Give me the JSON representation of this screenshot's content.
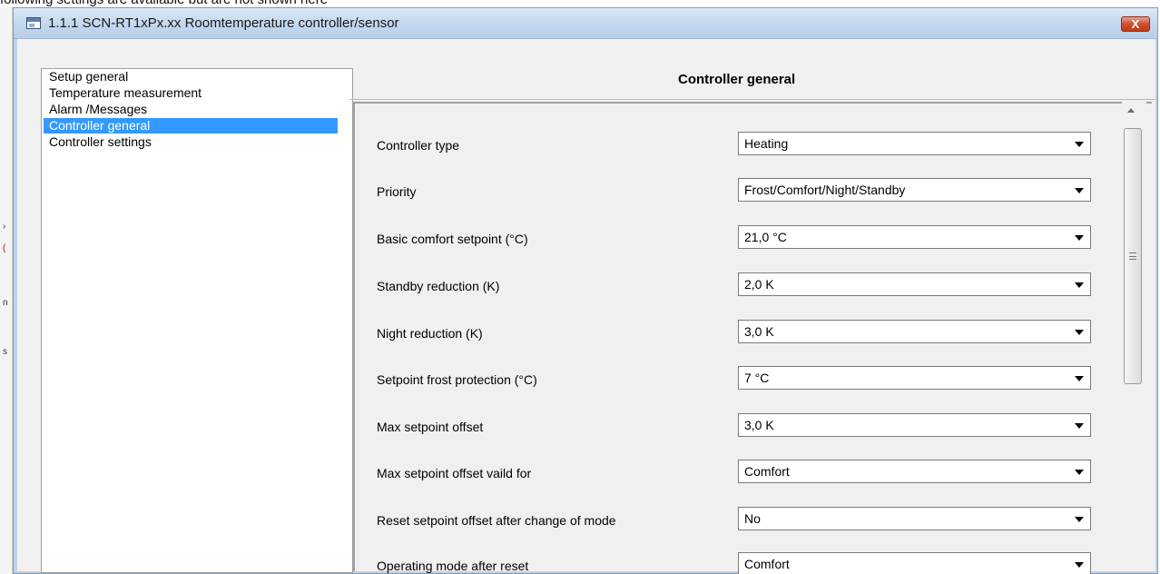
{
  "document_caption": "following settings are available but are not shown here",
  "window": {
    "title": "1.1.1 SCN-RT1xPx.xx Roomtemperature controller/sensor",
    "close_label": "X"
  },
  "tree": {
    "items": [
      {
        "label": "Setup general",
        "selected": false
      },
      {
        "label": "Temperature measurement",
        "selected": false
      },
      {
        "label": "Alarm /Messages",
        "selected": false
      },
      {
        "label": "Controller general",
        "selected": true
      },
      {
        "label": "Controller settings",
        "selected": false
      }
    ]
  },
  "panel": {
    "title": "Controller general",
    "params": [
      {
        "label": "Controller type",
        "value": "Heating"
      },
      {
        "label": "Priority",
        "value": "Frost/Comfort/Night/Standby"
      },
      {
        "label": "Basic comfort setpoint (°C)",
        "value": "21,0 °C"
      },
      {
        "label": "Standby reduction (K)",
        "value": "2,0 K"
      },
      {
        "label": "Night reduction (K)",
        "value": "3,0 K"
      },
      {
        "label": "Setpoint frost protection (°C)",
        "value": "7 °C"
      },
      {
        "label": "Max setpoint offset",
        "value": "3,0 K"
      },
      {
        "label": "Max setpoint offset vaild for",
        "value": "Comfort"
      },
      {
        "label": "Reset setpoint offset after change of mode",
        "value": "No"
      },
      {
        "label": "Operating mode after reset",
        "value": "Comfort"
      }
    ]
  },
  "colors": {
    "selection": "#3399ff",
    "titlebar": "#c2d6ee",
    "close_button": "#c0391f"
  }
}
